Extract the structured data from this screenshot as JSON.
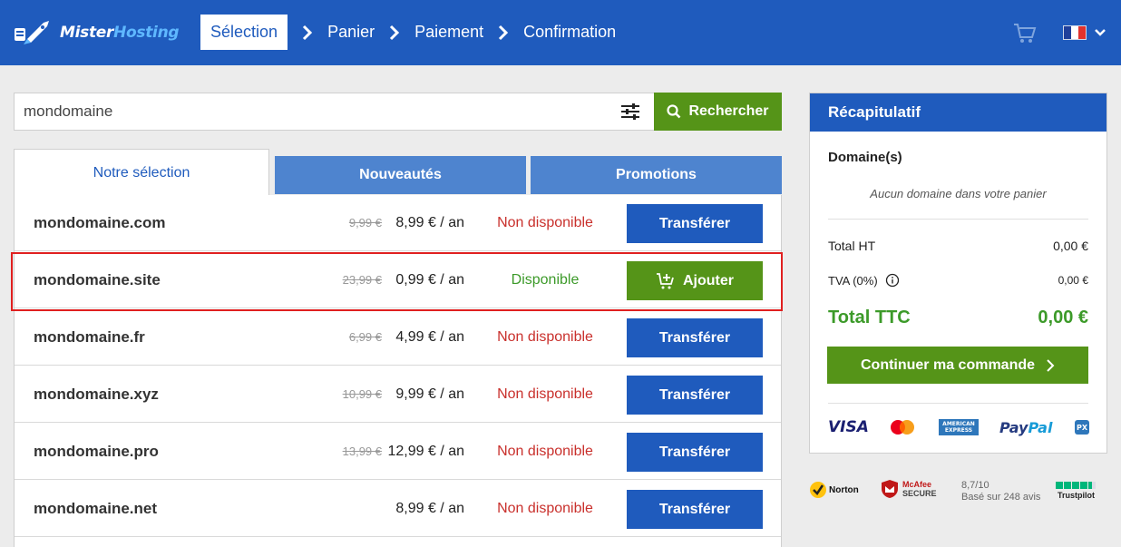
{
  "brand": {
    "name_part1": "Mister",
    "name_part2": "Hosting"
  },
  "steps": [
    "Sélection",
    "Panier",
    "Paiement",
    "Confirmation"
  ],
  "search": {
    "value": "mondomaine",
    "button_label": "Rechercher"
  },
  "tabs": [
    "Notre sélection",
    "Nouveautés",
    "Promotions"
  ],
  "domains": [
    {
      "name": "mondomaine.com",
      "old_price": "9,99 €",
      "price": "8,99 € / an",
      "status": "Non disponible",
      "action": "Transférer"
    },
    {
      "name": "mondomaine.site",
      "old_price": "23,99 €",
      "price": "0,99 € / an",
      "status": "Disponible",
      "action": "Ajouter"
    },
    {
      "name": "mondomaine.fr",
      "old_price": "6,99 €",
      "price": "4,99 € / an",
      "status": "Non disponible",
      "action": "Transférer"
    },
    {
      "name": "mondomaine.xyz",
      "old_price": "10,99 €",
      "price": "9,99 € / an",
      "status": "Non disponible",
      "action": "Transférer"
    },
    {
      "name": "mondomaine.pro",
      "old_price": "13,99 €",
      "price": "12,99 € / an",
      "status": "Non disponible",
      "action": "Transférer"
    },
    {
      "name": "mondomaine.net",
      "old_price": "",
      "price": "8,99 € / an",
      "status": "Non disponible",
      "action": "Transférer"
    }
  ],
  "recap": {
    "title": "Récapitulatif",
    "domains_label": "Domaine(s)",
    "empty_text": "Aucun domaine dans votre panier",
    "total_ht_label": "Total HT",
    "total_ht_value": "0,00 €",
    "tva_label": "TVA (0%)",
    "tva_value": "0,00 €",
    "total_ttc_label": "Total TTC",
    "total_ttc_value": "0,00 €",
    "continue_label": "Continuer ma commande"
  },
  "payments": {
    "visa": "VISA",
    "amex_line1": "AMERICAN",
    "amex_line2": "EXPRESS",
    "paypal_1": "Pay",
    "paypal_2": "Pal",
    "px": "PX"
  },
  "trust": {
    "norton": "Norton",
    "mcafee_line1": "McAfee",
    "mcafee_line2": "SECURE",
    "score": "8,7/10",
    "reviews": "Basé sur 248 avis",
    "trustpilot": "Trustpilot"
  },
  "colors": {
    "header": "#1f5bbd",
    "accent_green": "#559418",
    "tab_blue": "#4e84cf",
    "unavailable": "#c9302c",
    "available": "#3c9a29",
    "highlight": "#e02020"
  }
}
